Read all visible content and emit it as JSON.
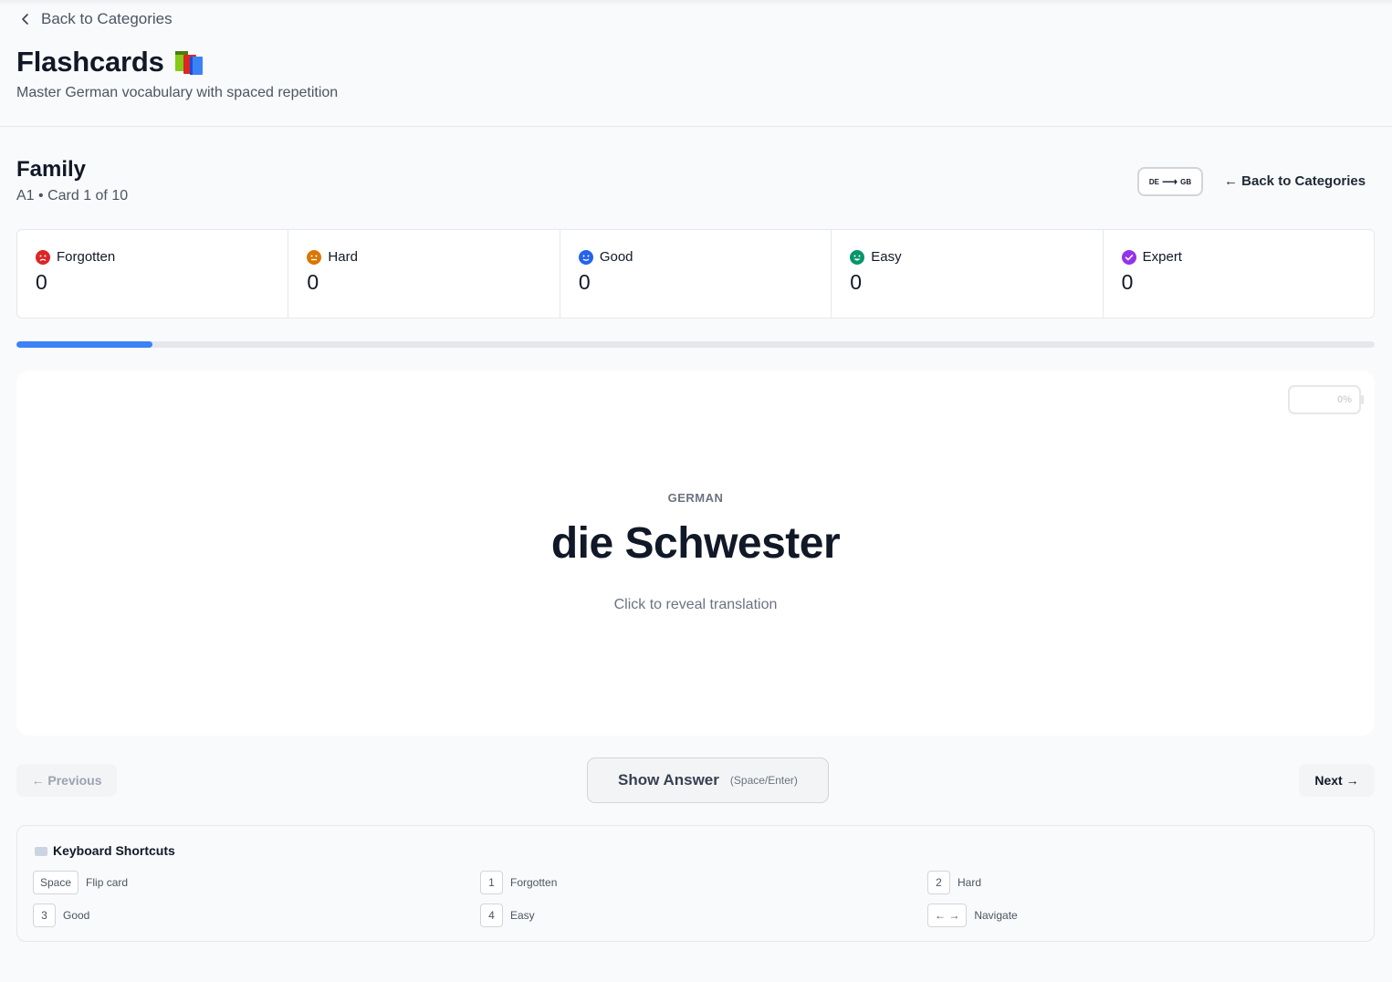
{
  "header": {
    "back_label": "Back to Categories",
    "title": "Flashcards",
    "subtitle": "Master German vocabulary with spaced repetition"
  },
  "deck": {
    "title": "Family",
    "meta": "A1 • Card 1 of 10",
    "lang_from": "DE",
    "lang_to": "GB",
    "back_label": "← Back to Categories"
  },
  "stats": [
    {
      "label": "Forgotten",
      "count": "0",
      "color": "#dc2626",
      "icon": "frown-face-icon"
    },
    {
      "label": "Hard",
      "count": "0",
      "color": "#d97706",
      "icon": "neutral-face-icon"
    },
    {
      "label": "Good",
      "count": "0",
      "color": "#2563eb",
      "icon": "smile-face-icon"
    },
    {
      "label": "Easy",
      "count": "0",
      "color": "#059669",
      "icon": "happy-face-icon"
    },
    {
      "label": "Expert",
      "count": "0",
      "color": "#9333ea",
      "icon": "check-circle-icon"
    }
  ],
  "progress": {
    "fraction": 0.1
  },
  "card": {
    "badge": "0%",
    "language": "GERMAN",
    "word": "die Schwester",
    "hint": "Click to reveal translation"
  },
  "controls": {
    "previous": "← Previous",
    "show_answer": "Show Answer",
    "show_answer_hint": "(Space/Enter)",
    "next": "Next →"
  },
  "shortcuts": {
    "title": "Keyboard Shortcuts",
    "items": [
      {
        "key": "Space",
        "action": "Flip card"
      },
      {
        "key": "1",
        "action": "Forgotten"
      },
      {
        "key": "2",
        "action": "Hard"
      },
      {
        "key": "3",
        "action": "Good"
      },
      {
        "key": "4",
        "action": "Easy"
      },
      {
        "key": "← →",
        "action": "Navigate"
      }
    ]
  },
  "colors": {
    "accent": "#3b82f6",
    "text": "#111827",
    "muted": "#6b7280"
  }
}
